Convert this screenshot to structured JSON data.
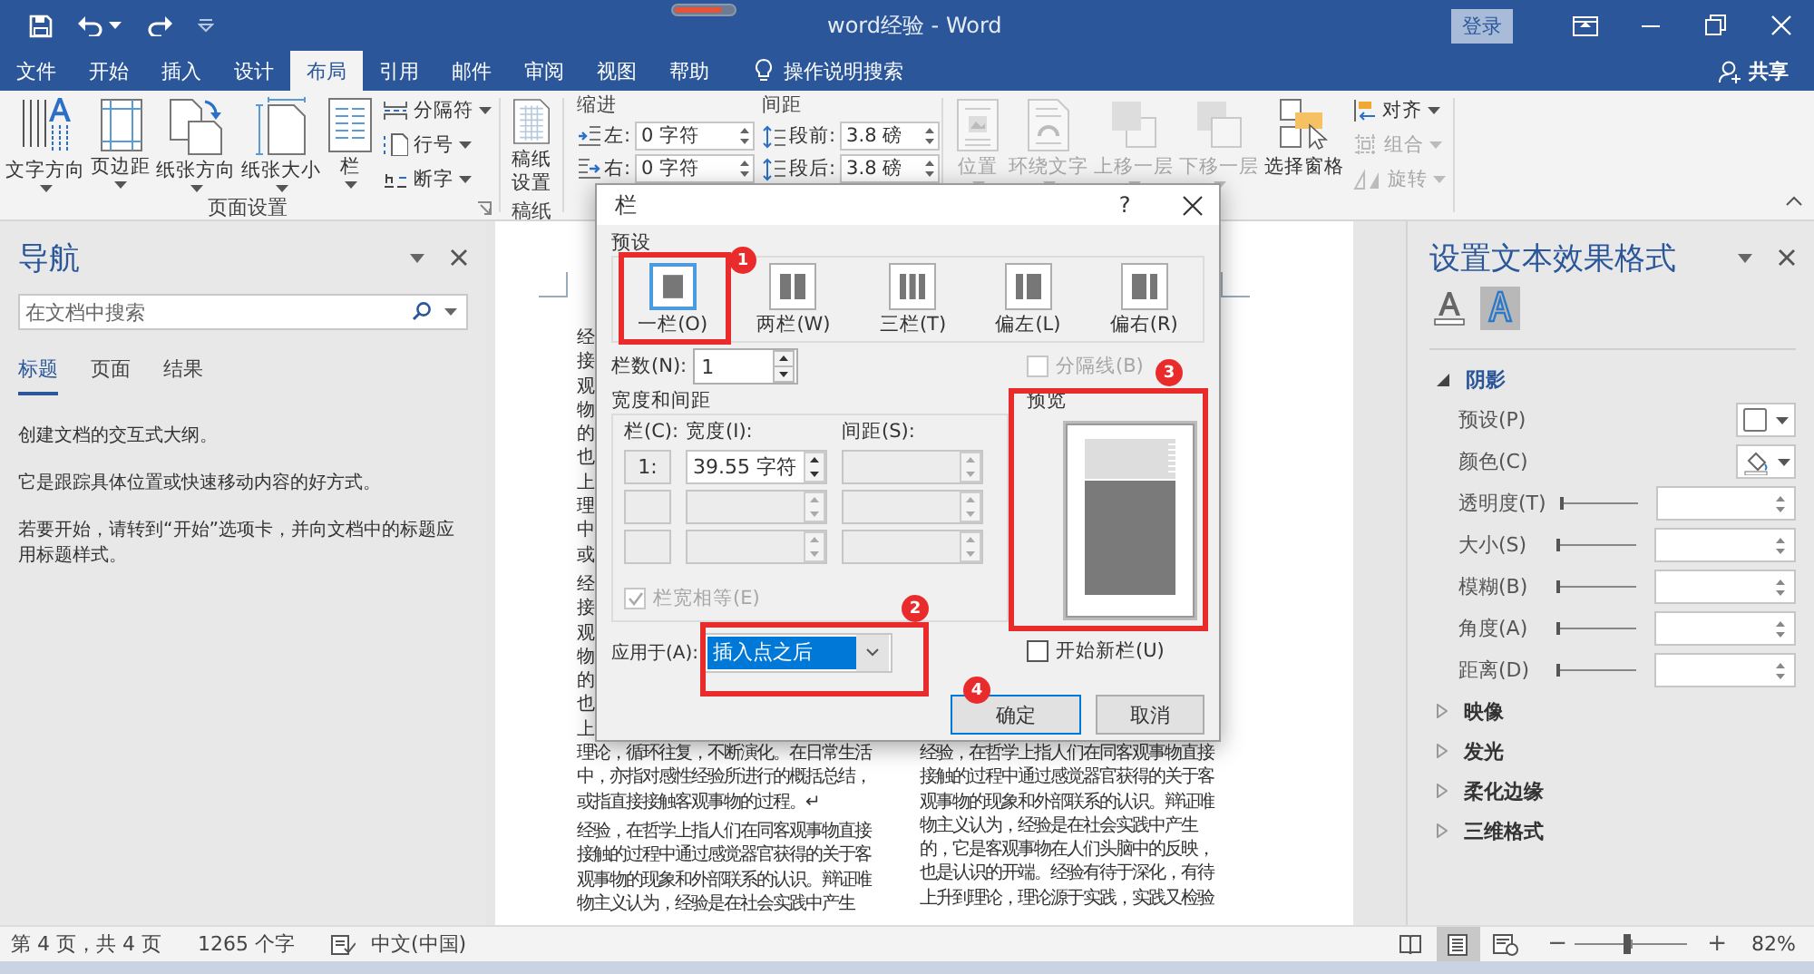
{
  "window": {
    "title": "word经验 - Word",
    "quick_access": [
      {
        "kind": "save"
      },
      {
        "kind": "undo"
      },
      {
        "kind": "redo"
      },
      {
        "kind": "customize"
      }
    ],
    "sign_in": "登录",
    "controls": [
      {
        "kind": "ribbon-options"
      },
      {
        "kind": "minimize"
      },
      {
        "kind": "restore"
      },
      {
        "kind": "close"
      }
    ]
  },
  "tabs": [
    {
      "label": "文件",
      "selected": false
    },
    {
      "label": "开始",
      "selected": false
    },
    {
      "label": "插入",
      "selected": false
    },
    {
      "label": "设计",
      "selected": false
    },
    {
      "label": "布局",
      "selected": true
    },
    {
      "label": "引用",
      "selected": false
    },
    {
      "label": "邮件",
      "selected": false
    },
    {
      "label": "审阅",
      "selected": false
    },
    {
      "label": "视图",
      "selected": false
    },
    {
      "label": "帮助",
      "selected": false
    }
  ],
  "tell_me": "操作说明搜索",
  "share": "共享",
  "ribbon": {
    "page_setup": {
      "label": "页面设置",
      "big_buttons": [
        {
          "label": "文字方向",
          "kind": "text-direction"
        },
        {
          "label": "页边距",
          "kind": "margins"
        },
        {
          "label": "纸张方向",
          "kind": "orientation"
        },
        {
          "label": "纸张大小",
          "kind": "size"
        },
        {
          "label": "栏",
          "kind": "columns"
        }
      ],
      "small_buttons": [
        {
          "label": "分隔符",
          "kind": "breaks"
        },
        {
          "label": "行号",
          "kind": "line-numbers"
        },
        {
          "label": "断字",
          "kind": "hyphenation"
        }
      ]
    },
    "draft": {
      "label": "稿纸",
      "button": "稿纸设置"
    },
    "paragraph": {
      "indent_label": "缩进",
      "spacing_label": "间距",
      "indent": [
        {
          "label": "左:",
          "value": "0 字符",
          "kind": "indent-left"
        },
        {
          "label": "右:",
          "value": "0 字符",
          "kind": "indent-right"
        }
      ],
      "spacing": [
        {
          "label": "段前:",
          "value": "3.8 磅",
          "kind": "space-before"
        },
        {
          "label": "段后:",
          "value": "3.8 磅",
          "kind": "space-after"
        }
      ]
    },
    "arrange": {
      "big_buttons": [
        {
          "label": "位置",
          "kind": "position",
          "disabled": true
        },
        {
          "label": "环绕文字",
          "kind": "wrap",
          "disabled": true
        },
        {
          "label": "上移一层",
          "kind": "forward",
          "disabled": true
        },
        {
          "label": "下移一层",
          "kind": "backward",
          "disabled": true
        },
        {
          "label": "选择窗格",
          "kind": "selection-pane",
          "disabled": false
        }
      ],
      "small_buttons": [
        {
          "label": "对齐",
          "kind": "align",
          "disabled": false
        },
        {
          "label": "组合",
          "kind": "group",
          "disabled": true
        },
        {
          "label": "旋转",
          "kind": "rotate",
          "disabled": true
        }
      ]
    }
  },
  "navigation": {
    "title": "导航",
    "search": {
      "placeholder": "在文档中搜索"
    },
    "tabs": [
      {
        "label": "标题",
        "selected": true
      },
      {
        "label": "页面",
        "selected": false
      },
      {
        "label": "结果",
        "selected": false
      }
    ],
    "paragraphs": [
      "创建文档的交互式大纲。",
      "它是跟踪具体位置或快速移动内容的好方式。",
      "若要开始，请转到“开始”选项卡，并向文档中的标题应用标题样式。"
    ]
  },
  "document": {
    "columns": [
      {
        "paragraphs": [
          [
            "经",
            "接",
            "观",
            "物",
            "的",
            "也",
            "上",
            "理",
            "中",
            "或"
          ],
          [
            "经",
            "接",
            "观",
            "物",
            "的",
            "也",
            "上",
            "理论，循环往复，不断演化。在日常生活",
            "中，亦指对感性经验所进行的概括总结，",
            "或指直接接触客观事物的过程。↵"
          ],
          [
            "经验，在哲学上指人们在同客观事物直接",
            "接触的过程中通过感觉器官获得的关于客",
            "观事物的现象和外部联系的认识。辩证唯",
            "物主义认为，经验是在社会实践中产生"
          ]
        ]
      },
      {
        "paragraphs": [
          [
            "经验，在哲学上指人们在同客观事物直接",
            "接触的过程中通过感觉器官获得的关于客",
            "观事物的现象和外部联系的认识。辩证唯",
            "物主义认为，经验是在社会实践中产生",
            "的，它是客观事物在人们头脑中的反映，",
            "也是认识的开端。经验有待于深化，有待",
            "上升到理论，理论源于实践，实践又检验"
          ]
        ]
      }
    ]
  },
  "dialog": {
    "title": "栏",
    "help": "?",
    "preset_label": "预设",
    "presets": [
      {
        "label": "一栏(O)",
        "kind": "one",
        "selected": true
      },
      {
        "label": "两栏(W)",
        "kind": "two",
        "selected": false
      },
      {
        "label": "三栏(T)",
        "kind": "three",
        "selected": false
      },
      {
        "label": "偏左(L)",
        "kind": "left",
        "selected": false
      },
      {
        "label": "偏右(R)",
        "kind": "right",
        "selected": false
      }
    ],
    "count_label": "栏数(N):",
    "count": "1",
    "separator": {
      "label": "分隔线(B)",
      "checked": false,
      "disabled": true
    },
    "width_group": "宽度和间距",
    "headers": [
      "栏(C):",
      "宽度(I):",
      "间距(S):"
    ],
    "rows": [
      {
        "number": "1:",
        "width": "39.55 字符",
        "width_disabled": false,
        "spacing_disabled": true
      },
      {
        "width_disabled": true,
        "spacing_disabled": true
      },
      {
        "width_disabled": true,
        "spacing_disabled": true
      }
    ],
    "equal_width": {
      "label": "栏宽相等(E)",
      "checked": true,
      "disabled": true
    },
    "preview_label": "预览",
    "apply_label": "应用于(A):",
    "apply_value": "插入点之后",
    "new_column": {
      "label": "开始新栏(U)",
      "checked": false,
      "disabled": false
    },
    "buttons": [
      {
        "label": "确定",
        "default": true
      },
      {
        "label": "取消",
        "default": false
      }
    ],
    "annotations": [
      {
        "number": "1",
        "boxed": true
      },
      {
        "number": "2",
        "boxed": true
      },
      {
        "number": "3",
        "boxed": true
      },
      {
        "number": "4",
        "boxed": false
      }
    ]
  },
  "format_pane": {
    "title": "设置文本效果格式",
    "tabs": [
      {
        "kind": "fill",
        "selected": false
      },
      {
        "kind": "effects",
        "selected": true
      }
    ],
    "sections": [
      {
        "label": "阴影",
        "expanded": true,
        "rows": [
          {
            "label": "预设(P)",
            "kind": "preset"
          },
          {
            "label": "颜色(C)",
            "kind": "color"
          },
          {
            "label": "透明度(T)",
            "kind": "slider",
            "level": 0
          },
          {
            "label": "大小(S)",
            "kind": "slider",
            "level": 0
          },
          {
            "label": "模糊(B)",
            "kind": "slider",
            "level": 0
          },
          {
            "label": "角度(A)",
            "kind": "slider",
            "level": 0
          },
          {
            "label": "距离(D)",
            "kind": "slider",
            "level": 0
          }
        ]
      },
      {
        "label": "映像",
        "expanded": false
      },
      {
        "label": "发光",
        "expanded": false
      },
      {
        "label": "柔化边缘",
        "expanded": false
      },
      {
        "label": "三维格式",
        "expanded": false
      }
    ]
  },
  "status_bar": {
    "page": "第 4 页，共 4 页",
    "words": "1265 个字",
    "language": "中文(中国)",
    "views": [
      {
        "kind": "read",
        "selected": false
      },
      {
        "kind": "print",
        "selected": true
      },
      {
        "kind": "web",
        "selected": false
      }
    ],
    "zoom": {
      "minus": "−",
      "plus": "+",
      "level": 0.48,
      "reading": "82%"
    }
  }
}
